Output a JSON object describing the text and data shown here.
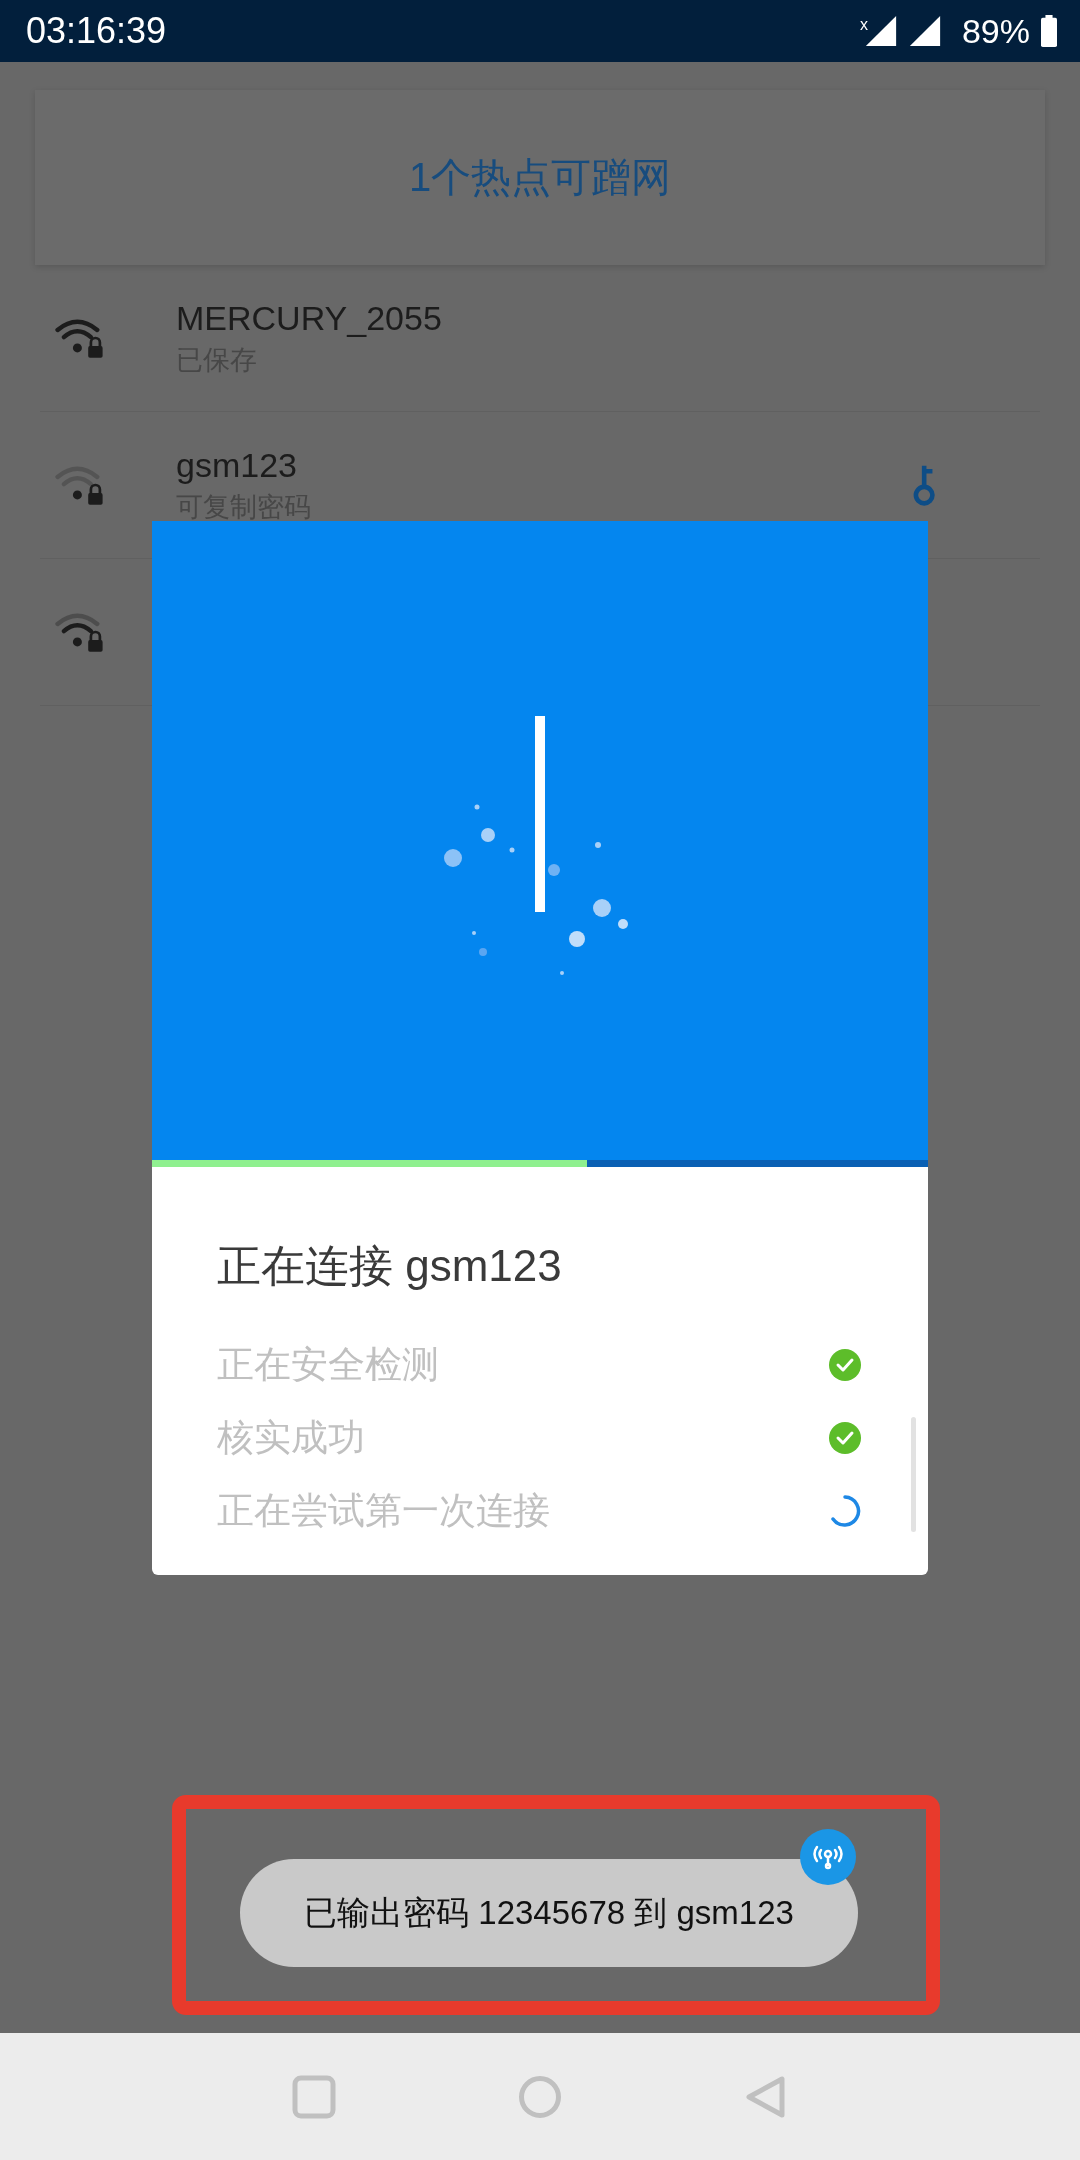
{
  "status_bar": {
    "time": "03:16:39",
    "sim_label": "x",
    "battery": "89%"
  },
  "header": {
    "title": "1个热点可蹭网"
  },
  "networks": [
    {
      "name": "MERCURY_2055",
      "status": "已保存",
      "weak_signal": false,
      "copy_key": false
    },
    {
      "name": "gsm123",
      "status": "可复制密码",
      "weak_signal": true,
      "copy_key": true
    }
  ],
  "dialog": {
    "progress": {
      "level": 0.56
    },
    "title": "正在连接 gsm123",
    "steps": [
      {
        "label": "正在安全检测",
        "done": true
      },
      {
        "label": "核实成功",
        "done": true
      },
      {
        "label": "正在尝试第一次连接",
        "done": false
      }
    ]
  },
  "toast": {
    "text": "已输出密码 12345678 到 gsm123",
    "highlighted": true
  }
}
